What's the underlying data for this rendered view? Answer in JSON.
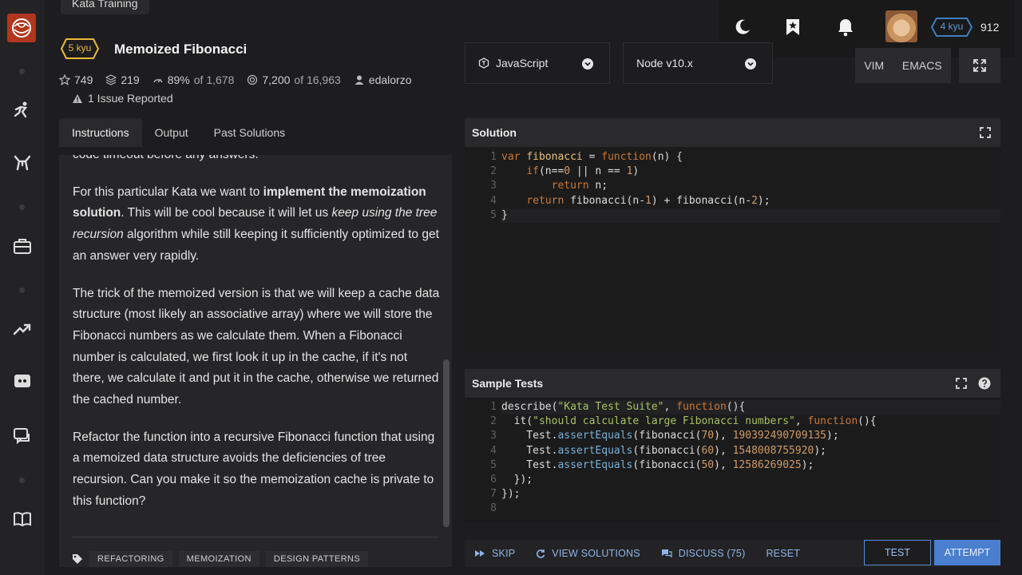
{
  "header": {
    "training_label": "Kata Training",
    "kyu": "5 kyu",
    "title": "Memoized Fibonacci",
    "stats": {
      "stars": "749",
      "collections": "219",
      "satisfaction_pct": "89%",
      "satisfaction_of": "of 1,678",
      "completed": "7,200",
      "completed_of": "of 16,963",
      "author": "edalorzo"
    },
    "issues": "1 Issue Reported"
  },
  "tabs": [
    "Instructions",
    "Output",
    "Past Solutions"
  ],
  "description": {
    "cut_line": "code timeout before any answers.",
    "p1_a": "For this particular Kata we want to ",
    "p1_bold": "implement the memoization solution",
    "p1_b": ". This will be cool because it will let us ",
    "p1_italic": "keep using the tree recursion",
    "p1_c": " algorithm while still keeping it sufficiently optimized to get an answer very rapidly.",
    "p2": "The trick of the memoized version is that we will keep a cache data structure (most likely an associative array) where we will store the Fibonacci numbers as we calculate them. When a Fibonacci number is calculated, we first look it up in the cache, if it's not there, we calculate it and put it in the cache, otherwise we returned the cached number.",
    "p3": "Refactor the function into a recursive Fibonacci function that using a memoized data structure avoids the deficiencies of tree recursion. Can you make it so the memoization cache is private to this function?"
  },
  "tags": [
    "REFACTORING",
    "MEMOIZATION",
    "DESIGN PATTERNS"
  ],
  "topbar": {
    "rank": "4 kyu",
    "honor": "912"
  },
  "language": "JavaScript",
  "runtime": "Node v10.x",
  "editor_modes": [
    "VIM",
    "EMACS"
  ],
  "solution": {
    "title": "Solution",
    "line_numbers": [
      "1",
      "2",
      "3",
      "4",
      "5"
    ]
  },
  "tests": {
    "title": "Sample Tests",
    "line_numbers": [
      "1",
      "2",
      "3",
      "4",
      "5",
      "6",
      "7",
      "8"
    ]
  },
  "actions": {
    "skip": "SKIP",
    "view_solutions": "VIEW SOLUTIONS",
    "discuss": "DISCUSS (75)",
    "reset": "RESET",
    "test": "TEST",
    "attempt": "ATTEMPT"
  },
  "colors": {
    "accent": "#4a7fcf",
    "kyu_yellow": "#e8b93a",
    "rank_blue": "#3c7ebf",
    "logo_red": "#b1361e"
  }
}
